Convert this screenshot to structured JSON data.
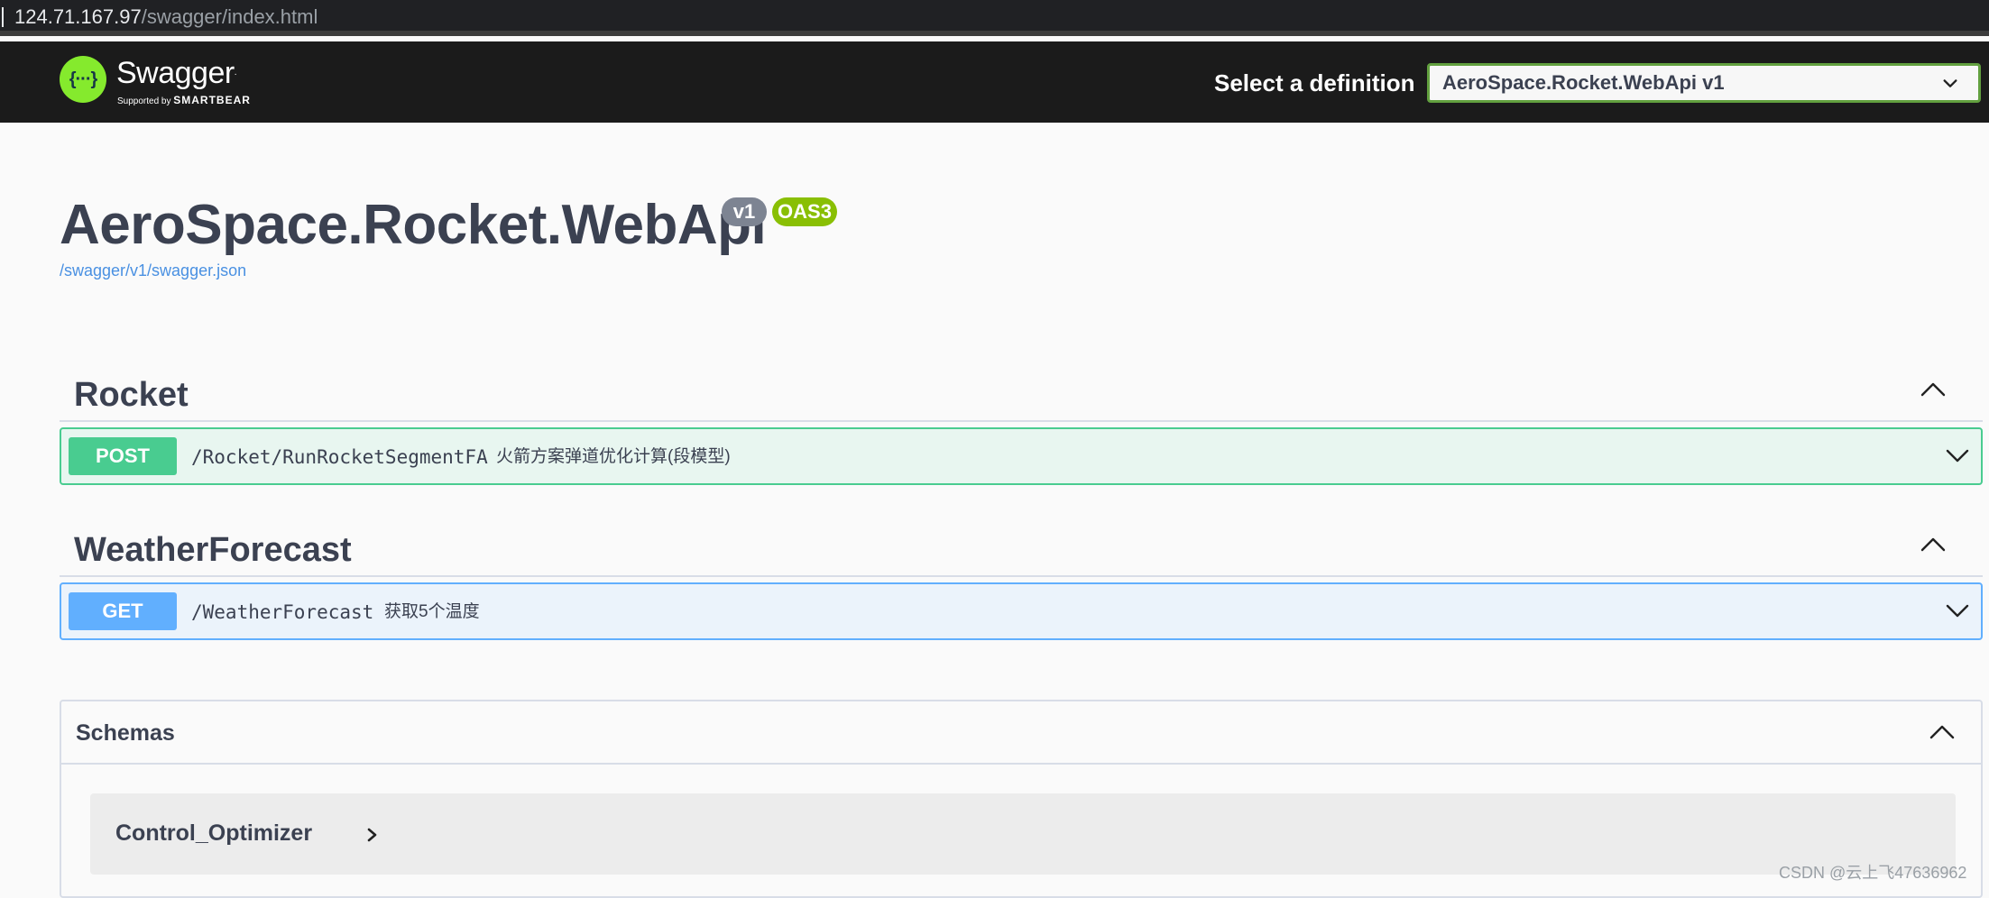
{
  "browser": {
    "url_host": "124.71.167.97",
    "url_path": "/swagger/index.html"
  },
  "topbar": {
    "logo_symbol": "{···}",
    "brand": "Swagger",
    "brand_tm": ".",
    "supported_by": "Supported by ",
    "supported_company": "SMARTBEAR",
    "definition_label": "Select a definition",
    "definition_selected": "AeroSpace.Rocket.WebApi v1",
    "icon": "chevron-down-icon"
  },
  "info": {
    "title": "AeroSpace.Rocket.WebApi",
    "version_badge": "v1",
    "oas_badge": "OAS3",
    "spec_link": "/swagger/v1/swagger.json"
  },
  "tags": [
    {
      "name": "Rocket",
      "operations": [
        {
          "method": "POST",
          "path": "/Rocket/RunRocketSegmentFA",
          "summary": "火箭方案弹道优化计算(段模型)"
        }
      ]
    },
    {
      "name": "WeatherForecast",
      "operations": [
        {
          "method": "GET",
          "path": "/WeatherForecast",
          "summary": "获取5个温度"
        }
      ]
    }
  ],
  "schemas": {
    "title": "Schemas",
    "models": [
      {
        "name": "Control_Optimizer"
      }
    ]
  },
  "watermark": "CSDN @云上飞47636962",
  "colors": {
    "post": "#49cc90",
    "get": "#61affe",
    "badge_version": "#7d8492",
    "badge_oas": "#89bf04",
    "logo": "#85ea2d",
    "select_border": "#62a03f"
  }
}
